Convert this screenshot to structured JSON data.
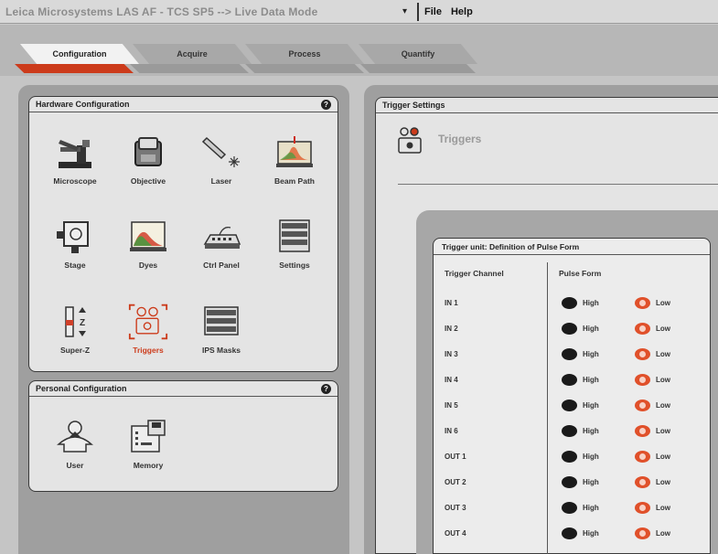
{
  "window": {
    "title": "Leica Microsystems LAS AF - TCS SP5 --> Live Data Mode",
    "dropdown_arrow": "▾"
  },
  "menu": {
    "items": [
      "File",
      "Help"
    ]
  },
  "tabs": [
    {
      "label": "Configuration",
      "active": true
    },
    {
      "label": "Acquire",
      "active": false
    },
    {
      "label": "Process",
      "active": false
    },
    {
      "label": "Quantify",
      "active": false
    }
  ],
  "hardware_panel": {
    "title": "Hardware Configuration",
    "help": "?",
    "items": [
      {
        "label": "Microscope",
        "icon": "microscope-icon"
      },
      {
        "label": "Objective",
        "icon": "objective-icon"
      },
      {
        "label": "Laser",
        "icon": "laser-icon"
      },
      {
        "label": "Beam Path",
        "icon": "beam-path-icon"
      },
      {
        "label": "Stage",
        "icon": "stage-icon"
      },
      {
        "label": "Dyes",
        "icon": "dyes-icon"
      },
      {
        "label": "Ctrl Panel",
        "icon": "ctrl-panel-icon"
      },
      {
        "label": "Settings",
        "icon": "settings-icon"
      },
      {
        "label": "Super-Z",
        "icon": "super-z-icon"
      },
      {
        "label": "Triggers",
        "icon": "triggers-icon",
        "selected": true
      },
      {
        "label": "IPS Masks",
        "icon": "ips-masks-icon"
      }
    ]
  },
  "personal_panel": {
    "title": "Personal Configuration",
    "help": "?",
    "items": [
      {
        "label": "User",
        "icon": "user-icon"
      },
      {
        "label": "Memory",
        "icon": "memory-icon"
      }
    ]
  },
  "trigger_settings": {
    "title": "Trigger Settings",
    "heading": "Triggers"
  },
  "pulse_form": {
    "title": "Trigger unit: Definition of Pulse Form",
    "col_channel": "Trigger Channel",
    "col_pulse": "Pulse Form",
    "high_label": "High",
    "low_label": "Low",
    "channels": [
      "IN 1",
      "IN 2",
      "IN 3",
      "IN 4",
      "IN 5",
      "IN 6",
      "OUT 1",
      "OUT 2",
      "OUT 3",
      "OUT 4"
    ]
  },
  "colors": {
    "accent": "#cc3b1b",
    "panel": "#e4e4e4",
    "shell": "#9f9f9f"
  }
}
